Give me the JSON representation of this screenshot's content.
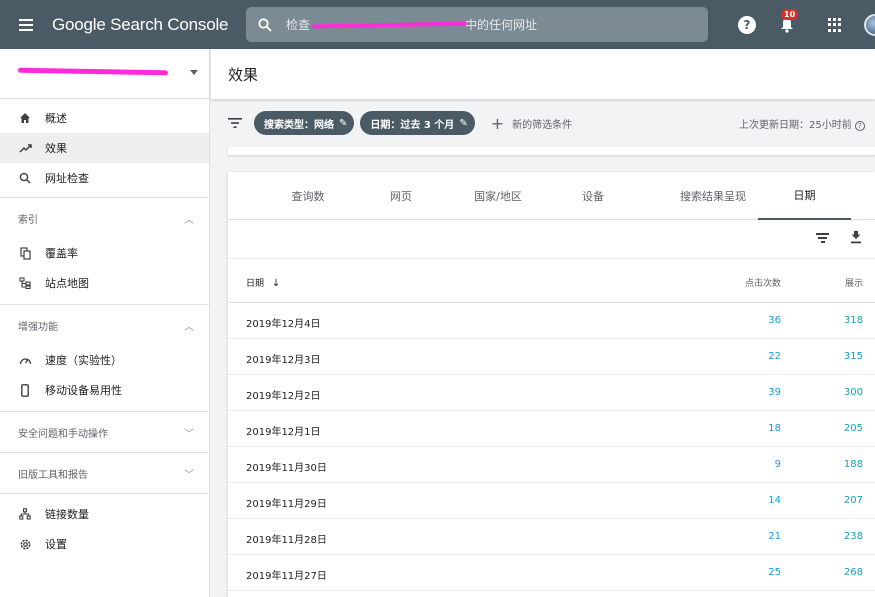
{
  "app": {
    "title": "Google Search Console",
    "search_placeholder_prefix": "检查",
    "search_placeholder_suffix": "中的任何网址",
    "notification_count": "10",
    "help_label": "?"
  },
  "sidebar": {
    "items_primary": [
      {
        "label": "概述",
        "icon": "home-icon"
      },
      {
        "label": "效果",
        "icon": "trending-up-icon",
        "active": true
      },
      {
        "label": "网址检查",
        "icon": "search-icon"
      }
    ],
    "groups": [
      {
        "header": "索引",
        "expanded": true,
        "items": [
          {
            "label": "覆盖率",
            "icon": "copy-icon"
          },
          {
            "label": "站点地图",
            "icon": "sitemap-icon"
          }
        ]
      },
      {
        "header": "增强功能",
        "expanded": true,
        "items": [
          {
            "label": "速度（实验性）",
            "icon": "speed-icon"
          },
          {
            "label": "移动设备易用性",
            "icon": "phone-icon"
          }
        ]
      },
      {
        "header": "安全问题和手动操作",
        "expanded": false,
        "items": []
      },
      {
        "header": "旧版工具和报告",
        "expanded": false,
        "items": []
      }
    ],
    "items_bottom": [
      {
        "label": "链接数量",
        "icon": "links-icon"
      },
      {
        "label": "设置",
        "icon": "gear-icon"
      }
    ]
  },
  "page": {
    "title": "效果"
  },
  "filters": {
    "search_type_chip": "搜索类型：网络",
    "date_chip": "日期：过去 3 个月",
    "add_filter_label": "新的筛选条件",
    "last_updated": "上次更新日期：25小时前"
  },
  "tabs": [
    {
      "label": "查询数"
    },
    {
      "label": "网页"
    },
    {
      "label": "国家/地区"
    },
    {
      "label": "设备"
    },
    {
      "label": "搜索结果呈现"
    },
    {
      "label": "日期",
      "active": true
    }
  ],
  "table": {
    "columns": {
      "date": "日期",
      "clicks": "点击次数",
      "impressions": "展示"
    },
    "rows": [
      {
        "date": "2019年12月4日",
        "clicks": "36",
        "impressions": "318"
      },
      {
        "date": "2019年12月3日",
        "clicks": "22",
        "impressions": "315"
      },
      {
        "date": "2019年12月2日",
        "clicks": "39",
        "impressions": "300"
      },
      {
        "date": "2019年12月1日",
        "clicks": "18",
        "impressions": "205"
      },
      {
        "date": "2019年11月30日",
        "clicks": "9",
        "impressions": "188"
      },
      {
        "date": "2019年11月29日",
        "clicks": "14",
        "impressions": "207"
      },
      {
        "date": "2019年11月28日",
        "clicks": "21",
        "impressions": "238"
      },
      {
        "date": "2019年11月27日",
        "clicks": "25",
        "impressions": "268"
      }
    ]
  },
  "colors": {
    "topbar": "#4a5b66",
    "clicks": "#1a9bd7",
    "impressions": "#12a4b8",
    "redaction": "#ff2bd9"
  }
}
